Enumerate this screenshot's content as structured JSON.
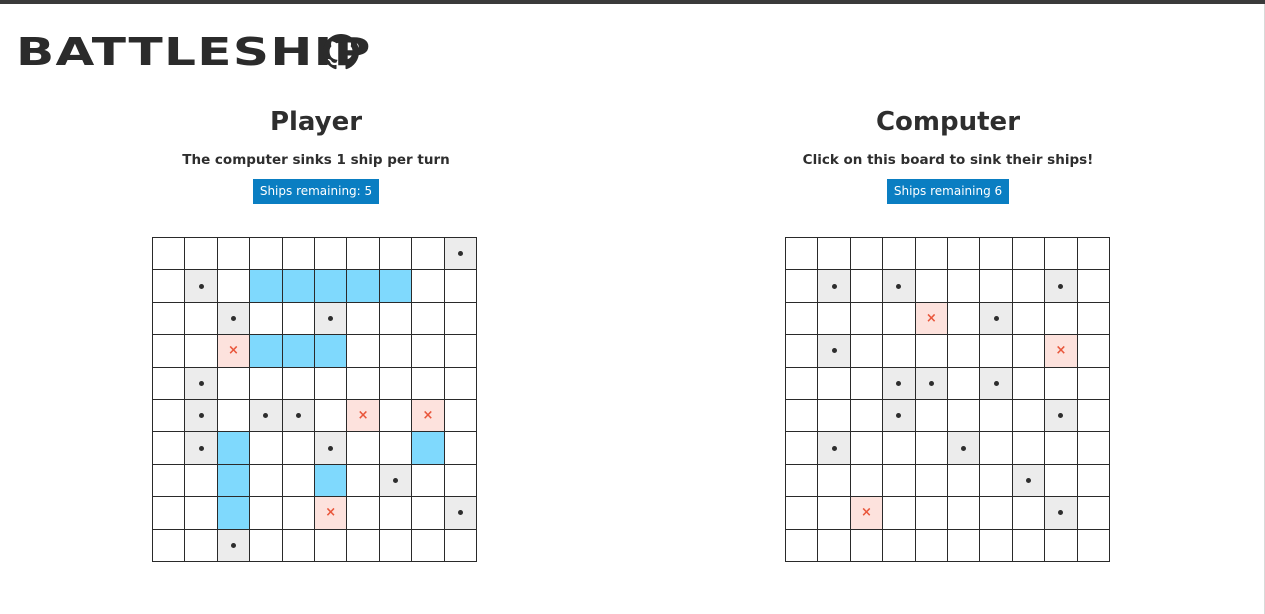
{
  "app": {
    "title": "BATTLESHIP",
    "github_icon": "github-icon"
  },
  "player": {
    "title": "Player",
    "message": "The computer sinks 1 ship per turn",
    "ships_remaining_label": "Ships remaining: 5",
    "ships_remaining": 5,
    "board": [
      [
        "empty",
        "empty",
        "empty",
        "empty",
        "empty",
        "empty",
        "empty",
        "empty",
        "empty",
        "miss"
      ],
      [
        "empty",
        "miss",
        "empty",
        "ship",
        "ship",
        "ship",
        "ship",
        "ship",
        "empty",
        "empty"
      ],
      [
        "empty",
        "empty",
        "miss",
        "empty",
        "empty",
        "miss",
        "empty",
        "empty",
        "empty",
        "empty"
      ],
      [
        "empty",
        "empty",
        "hit",
        "ship",
        "ship",
        "ship",
        "empty",
        "empty",
        "empty",
        "empty"
      ],
      [
        "empty",
        "miss",
        "empty",
        "empty",
        "empty",
        "empty",
        "empty",
        "empty",
        "empty",
        "empty"
      ],
      [
        "empty",
        "miss",
        "empty",
        "miss",
        "miss",
        "empty",
        "hit",
        "empty",
        "hit",
        "empty"
      ],
      [
        "empty",
        "miss",
        "ship",
        "empty",
        "empty",
        "miss",
        "empty",
        "empty",
        "ship",
        "empty"
      ],
      [
        "empty",
        "empty",
        "ship",
        "empty",
        "empty",
        "ship",
        "empty",
        "miss",
        "empty",
        "empty"
      ],
      [
        "empty",
        "empty",
        "ship",
        "empty",
        "empty",
        "hit",
        "empty",
        "empty",
        "empty",
        "miss"
      ],
      [
        "empty",
        "empty",
        "miss",
        "empty",
        "empty",
        "empty",
        "empty",
        "empty",
        "empty",
        "empty"
      ]
    ]
  },
  "computer": {
    "title": "Computer",
    "message": "Click on this board to sink their ships!",
    "ships_remaining_label": "Ships remaining 6",
    "ships_remaining": 6,
    "board": [
      [
        "empty",
        "empty",
        "empty",
        "empty",
        "empty",
        "empty",
        "empty",
        "empty",
        "empty",
        "empty"
      ],
      [
        "empty",
        "miss",
        "empty",
        "miss",
        "empty",
        "empty",
        "empty",
        "empty",
        "miss",
        "empty"
      ],
      [
        "empty",
        "empty",
        "empty",
        "empty",
        "hit",
        "empty",
        "miss",
        "empty",
        "empty",
        "empty"
      ],
      [
        "empty",
        "miss",
        "empty",
        "empty",
        "empty",
        "empty",
        "empty",
        "empty",
        "hit",
        "empty"
      ],
      [
        "empty",
        "empty",
        "empty",
        "miss",
        "miss",
        "empty",
        "miss",
        "empty",
        "empty",
        "empty"
      ],
      [
        "empty",
        "empty",
        "empty",
        "miss",
        "empty",
        "empty",
        "empty",
        "empty",
        "miss",
        "empty"
      ],
      [
        "empty",
        "miss",
        "empty",
        "empty",
        "empty",
        "miss",
        "empty",
        "empty",
        "empty",
        "empty"
      ],
      [
        "empty",
        "empty",
        "empty",
        "empty",
        "empty",
        "empty",
        "empty",
        "miss",
        "empty",
        "empty"
      ],
      [
        "empty",
        "empty",
        "hit",
        "empty",
        "empty",
        "empty",
        "empty",
        "empty",
        "miss",
        "empty"
      ],
      [
        "empty",
        "empty",
        "empty",
        "empty",
        "empty",
        "empty",
        "empty",
        "empty",
        "empty",
        "empty"
      ]
    ]
  },
  "markers": {
    "miss": "dot",
    "hit": "×"
  },
  "colors": {
    "badge": "#0a7ec2",
    "ship": "#7fd9fd",
    "miss_cell": "#ececec",
    "hit_cell": "#fde2dd",
    "hit_mark": "#e9563b",
    "top_bar": "#3a3a3a"
  }
}
